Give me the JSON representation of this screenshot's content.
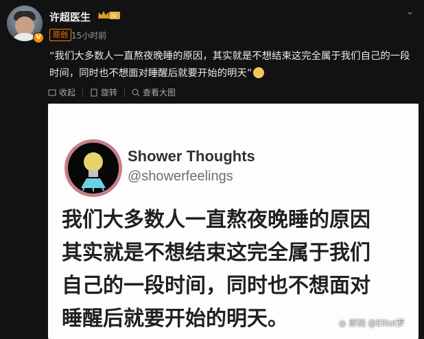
{
  "header": {
    "username": "许超医生",
    "level_badge": "IV",
    "original_tag": "原创",
    "timestamp": "15小时前"
  },
  "post": {
    "text": "“我们大多数人一直熬夜晚睡的原因，其实就是不想结束这完全属于我们自己的一段时间，同时也不想面对睡醒后就要开始的明天”"
  },
  "actions": {
    "collapse": "收起",
    "rotate": "旋转",
    "view_large": "查看大图"
  },
  "card": {
    "account_name": "Shower Thoughts",
    "account_handle": "@showerfeelings",
    "lines": [
      "我们大多数人一直熬夜晚睡的原因",
      "其实就是不想结束这完全属于我们",
      "自己的一段时间，同时也不想面对",
      "睡醒后就要开始的明天。"
    ]
  },
  "watermark": "即刻 @Elliot罗",
  "colors": {
    "accent": "#ff7a00",
    "background": "#121212",
    "card": "#fdfdfd"
  }
}
